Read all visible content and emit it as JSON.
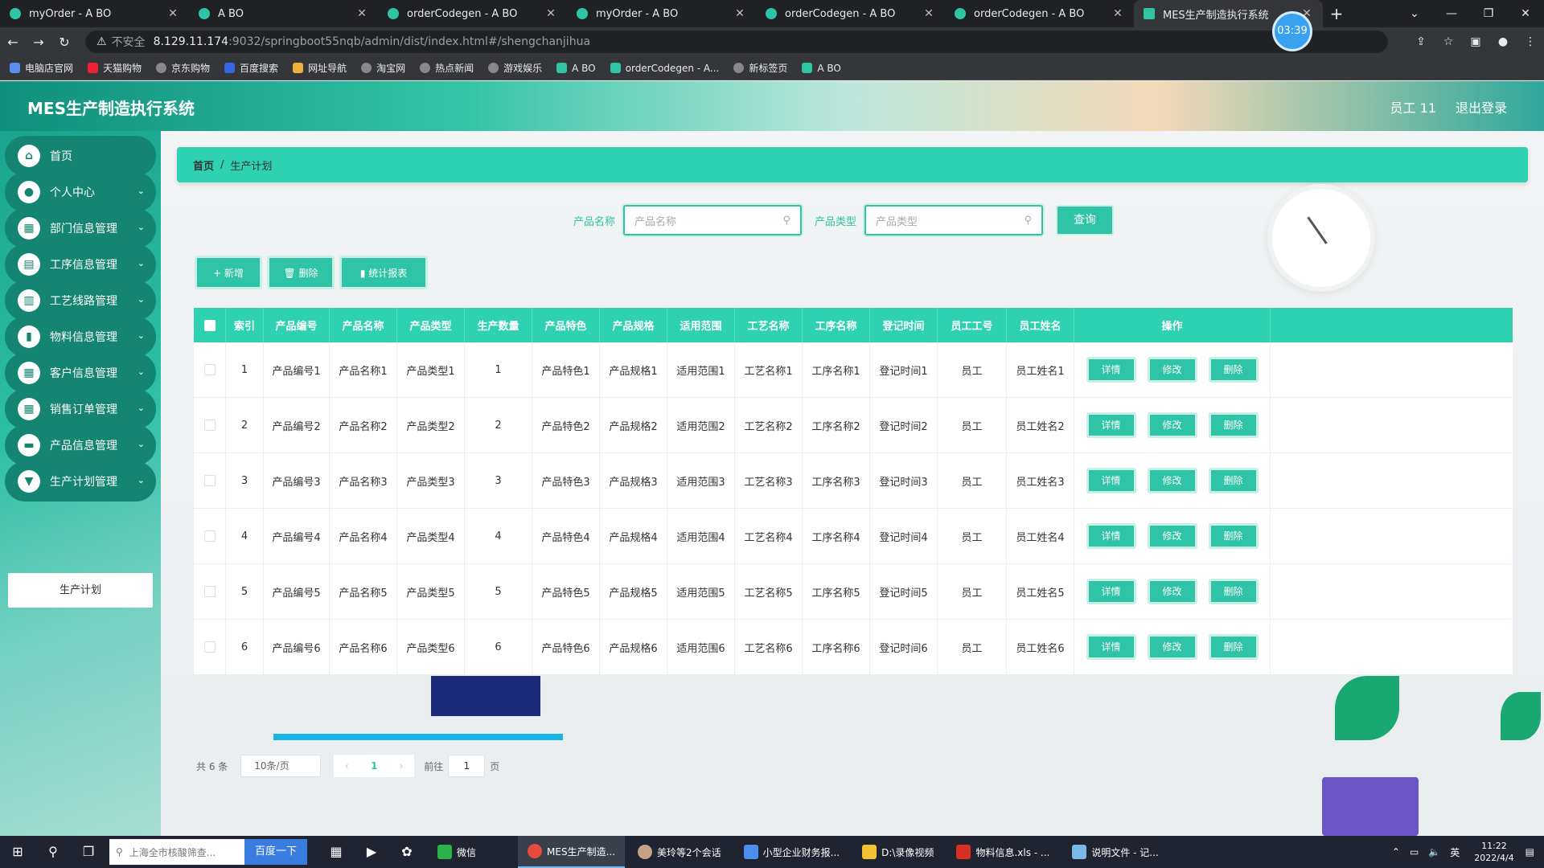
{
  "browser": {
    "tabs": [
      {
        "title": "myOrder - A BO"
      },
      {
        "title": "A BO"
      },
      {
        "title": "orderCodegen - A BO"
      },
      {
        "title": "myOrder - A BO"
      },
      {
        "title": "orderCodegen - A BO"
      },
      {
        "title": "orderCodegen - A BO"
      },
      {
        "title": "MES生产制造执行系统"
      }
    ],
    "timer": "03:39",
    "insecure": "不安全",
    "url_host": "8.129.11.174",
    "url_path": ":9032/springboot55nqb/admin/dist/index.html#/shengchanjihua",
    "bookmarks": [
      "电脑店官网",
      "天猫购物",
      "京东购物",
      "百度搜索",
      "网址导航",
      "淘宝网",
      "热点新闻",
      "游戏娱乐",
      "A BO",
      "orderCodegen - A...",
      "新标签页",
      "A BO"
    ]
  },
  "app": {
    "title": "MES生产制造执行系统",
    "user": "员工 11",
    "logout": "退出登录"
  },
  "sidebar": {
    "items": [
      {
        "label": "首页",
        "icon": "home-icon"
      },
      {
        "label": "个人中心",
        "icon": "user-icon"
      },
      {
        "label": "部门信息管理",
        "icon": "grid-icon"
      },
      {
        "label": "工序信息管理",
        "icon": "briefcase-icon"
      },
      {
        "label": "工艺线路管理",
        "icon": "chart-icon"
      },
      {
        "label": "物料信息管理",
        "icon": "bar-chart-icon"
      },
      {
        "label": "客户信息管理",
        "icon": "grid-icon"
      },
      {
        "label": "销售订单管理",
        "icon": "grid-icon"
      },
      {
        "label": "产品信息管理",
        "icon": "monitor-icon"
      },
      {
        "label": "生产计划管理",
        "icon": "trophy-icon"
      }
    ],
    "sub_active": "生产计划"
  },
  "breadcrumb": {
    "home": "首页",
    "sep": "/",
    "current": "生产计划"
  },
  "search": {
    "label1": "产品名称",
    "placeholder1": "产品名称",
    "label2": "产品类型",
    "placeholder2": "产品类型",
    "query": "查询"
  },
  "toolbar": {
    "add": "+ 新增",
    "delete": "🗑 删除",
    "report": "▮ 统计报表"
  },
  "table": {
    "headers": [
      "索引",
      "产品编号",
      "产品名称",
      "产品类型",
      "生产数量",
      "产品特色",
      "产品规格",
      "适用范围",
      "工艺名称",
      "工序名称",
      "登记时间",
      "员工工号",
      "员工姓名",
      "操作"
    ],
    "rows": [
      [
        "1",
        "产品编号1",
        "产品名称1",
        "产品类型1",
        "1",
        "产品特色1",
        "产品规格1",
        "适用范围1",
        "工艺名称1",
        "工序名称1",
        "登记时间1",
        "员工",
        "员工姓名1"
      ],
      [
        "2",
        "产品编号2",
        "产品名称2",
        "产品类型2",
        "2",
        "产品特色2",
        "产品规格2",
        "适用范围2",
        "工艺名称2",
        "工序名称2",
        "登记时间2",
        "员工",
        "员工姓名2"
      ],
      [
        "3",
        "产品编号3",
        "产品名称3",
        "产品类型3",
        "3",
        "产品特色3",
        "产品规格3",
        "适用范围3",
        "工艺名称3",
        "工序名称3",
        "登记时间3",
        "员工",
        "员工姓名3"
      ],
      [
        "4",
        "产品编号4",
        "产品名称4",
        "产品类型4",
        "4",
        "产品特色4",
        "产品规格4",
        "适用范围4",
        "工艺名称4",
        "工序名称4",
        "登记时间4",
        "员工",
        "员工姓名4"
      ],
      [
        "5",
        "产品编号5",
        "产品名称5",
        "产品类型5",
        "5",
        "产品特色5",
        "产品规格5",
        "适用范围5",
        "工艺名称5",
        "工序名称5",
        "登记时间5",
        "员工",
        "员工姓名5"
      ],
      [
        "6",
        "产品编号6",
        "产品名称6",
        "产品类型6",
        "6",
        "产品特色6",
        "产品规格6",
        "适用范围6",
        "工艺名称6",
        "工序名称6",
        "登记时间6",
        "员工",
        "员工姓名6"
      ]
    ],
    "actions": [
      "详情",
      "修改",
      "删除"
    ]
  },
  "pager": {
    "total": "共 6 条",
    "size": "10条/页",
    "current": "1",
    "goto_prefix": "前往",
    "goto_value": "1",
    "goto_suffix": "页"
  },
  "taskbar": {
    "search_placeholder": "上海全市核酸筛查...",
    "baidu": "百度一下",
    "apps": [
      "微信",
      "MES生产制造...",
      "美玲等2个会话",
      "小型企业财务报...",
      "D:\\录像视频",
      "物料信息.xls - ...",
      "说明文件 - 记..."
    ],
    "ime": "英",
    "time": "11:22",
    "date": "2022/4/4"
  },
  "colors": {
    "accent": "#2ec4a5",
    "header": "#2ed2b0",
    "sidebar_item": "#138571"
  }
}
